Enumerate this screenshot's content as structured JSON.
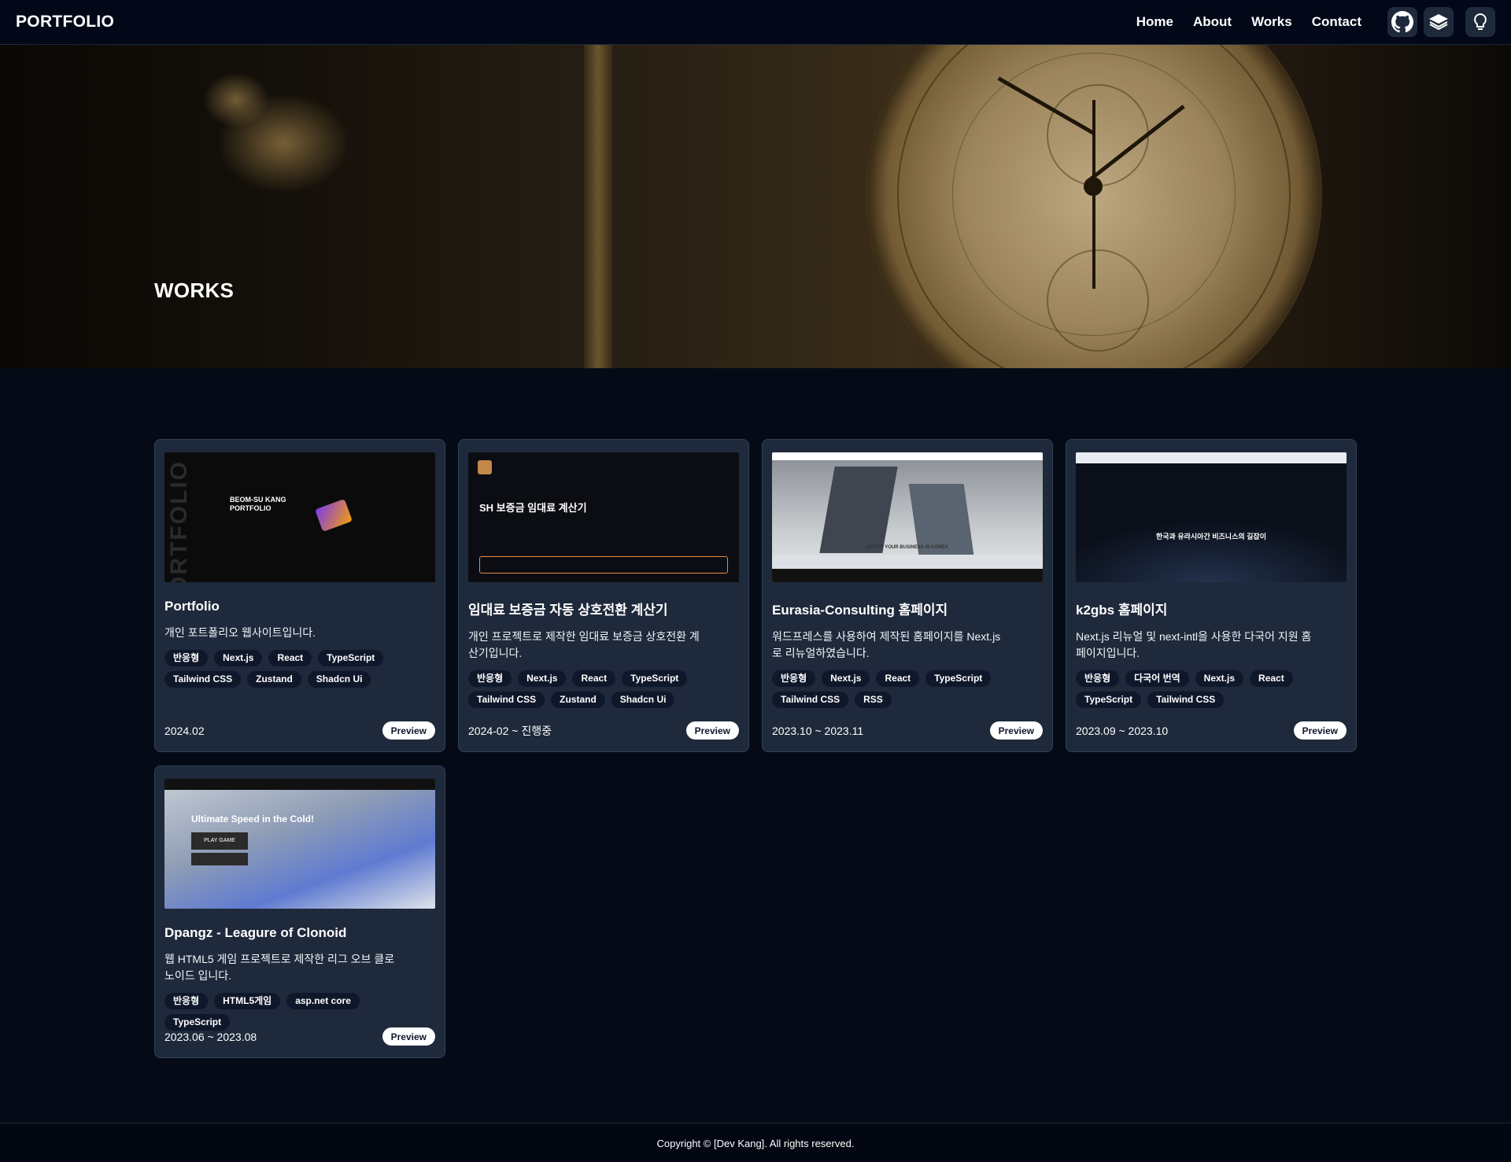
{
  "header": {
    "logo": "PORTFOLIO",
    "nav": [
      "Home",
      "About",
      "Works",
      "Contact"
    ],
    "icons": [
      "github-icon",
      "book-icon",
      "lightbulb-icon"
    ]
  },
  "hero": {
    "title": "WORKS"
  },
  "works": [
    {
      "title": "Portfolio",
      "description": "개인 포트폴리오 웹사이트입니다.",
      "tags": [
        "반응형",
        "Next.js",
        "React",
        "TypeScript",
        "Tailwind CSS",
        "Zustand",
        "Shadcn Ui"
      ],
      "date": "2024.02",
      "preview": "Preview",
      "thumb_text": "BEOM-SU KANG PORTFOLIO",
      "thumb_side": "PORTFOLIO"
    },
    {
      "title": "임대료 보증금 자동 상호전환 계산기",
      "description": "개인 프로젝트로 제작한 임대료 보증금 상호전환 계산기입니다.",
      "tags": [
        "반응형",
        "Next.js",
        "React",
        "TypeScript",
        "Tailwind CSS",
        "Zustand",
        "Shadcn Ui"
      ],
      "date": "2024-02 ~ 진행중",
      "preview": "Preview",
      "thumb_text": "SH 보증금 임대료 계산기"
    },
    {
      "title": "Eurasia-Consulting 홈페이지",
      "description": "워드프레스를 사용하여 제작된 홈페이지를 Next.js로 리뉴얼하였습니다.",
      "tags": [
        "반응형",
        "Next.js",
        "React",
        "TypeScript",
        "Tailwind CSS",
        "RSS"
      ],
      "date": "2023.10 ~ 2023.11",
      "preview": "Preview",
      "thumb_text": "SET UP YOUR BUSINESS IN KOREA"
    },
    {
      "title": "k2gbs 홈페이지",
      "description": "Next.js 리뉴얼 및 next-intl을 사용한 다국어 지원 홈페이지입니다.",
      "tags": [
        "반응형",
        "다국어 번역",
        "Next.js",
        "React",
        "TypeScript",
        "Tailwind CSS"
      ],
      "date": "2023.09 ~ 2023.10",
      "preview": "Preview",
      "thumb_text": "한국과 유라시아간 비즈니스의 길잡이"
    },
    {
      "title": "Dpangz - Leagure of Clonoid",
      "description": "웹 HTML5 게임 프로젝트로 제작한 리그 오브 클로노이드 입니다.",
      "tags": [
        "반응형",
        "HTML5게임",
        "asp.net core",
        "TypeScript"
      ],
      "date": "2023.06 ~ 2023.08",
      "preview": "Preview",
      "thumb_text": "Ultimate Speed in the Cold!",
      "thumb_button": "PLAY GAME"
    }
  ],
  "footer": {
    "copyright": "Copyright © [Dev Kang]. All rights reserved."
  }
}
